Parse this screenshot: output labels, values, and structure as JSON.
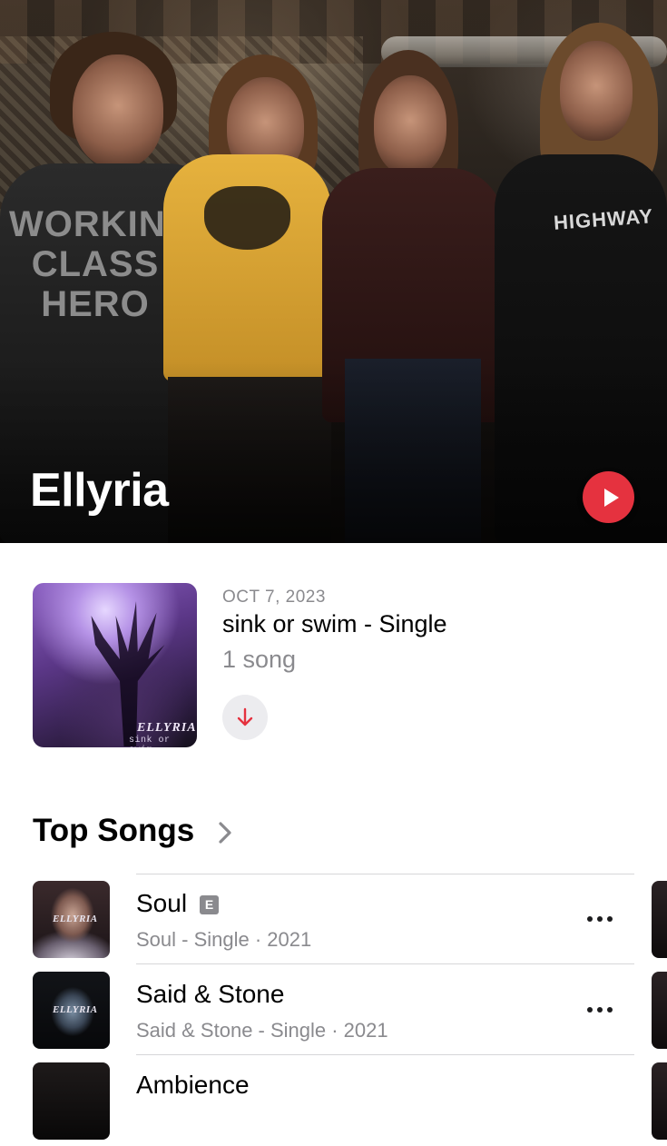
{
  "artist": {
    "name": "Ellyria",
    "shirt_text_1": "WORKING CLASS HERO",
    "shirt_text_2": "HIGHWAY"
  },
  "latest_release": {
    "date": "OCT 7, 2023",
    "title": "sink or swim - Single",
    "count": "1 song",
    "art_logo": "ELLYRIA",
    "art_subtitle": "sink or swim"
  },
  "top_songs": {
    "title": "Top Songs",
    "items": [
      {
        "title": "Soul",
        "explicit": "E",
        "meta": "Soul - Single · 2021",
        "art_logo": "ELLYRIA"
      },
      {
        "title": "Said & Stone",
        "meta": "Said & Stone - Single · 2021",
        "art_logo": "ELLYRIA"
      },
      {
        "title": "Ambience"
      }
    ]
  },
  "colors": {
    "accent": "#e5323f",
    "secondary_text": "#8a8a8e",
    "button_bg": "#ececef"
  },
  "icons": {
    "play": "play-icon",
    "download": "arrow-down-icon",
    "more": "ellipsis-icon",
    "chevron": "chevron-right-icon"
  }
}
